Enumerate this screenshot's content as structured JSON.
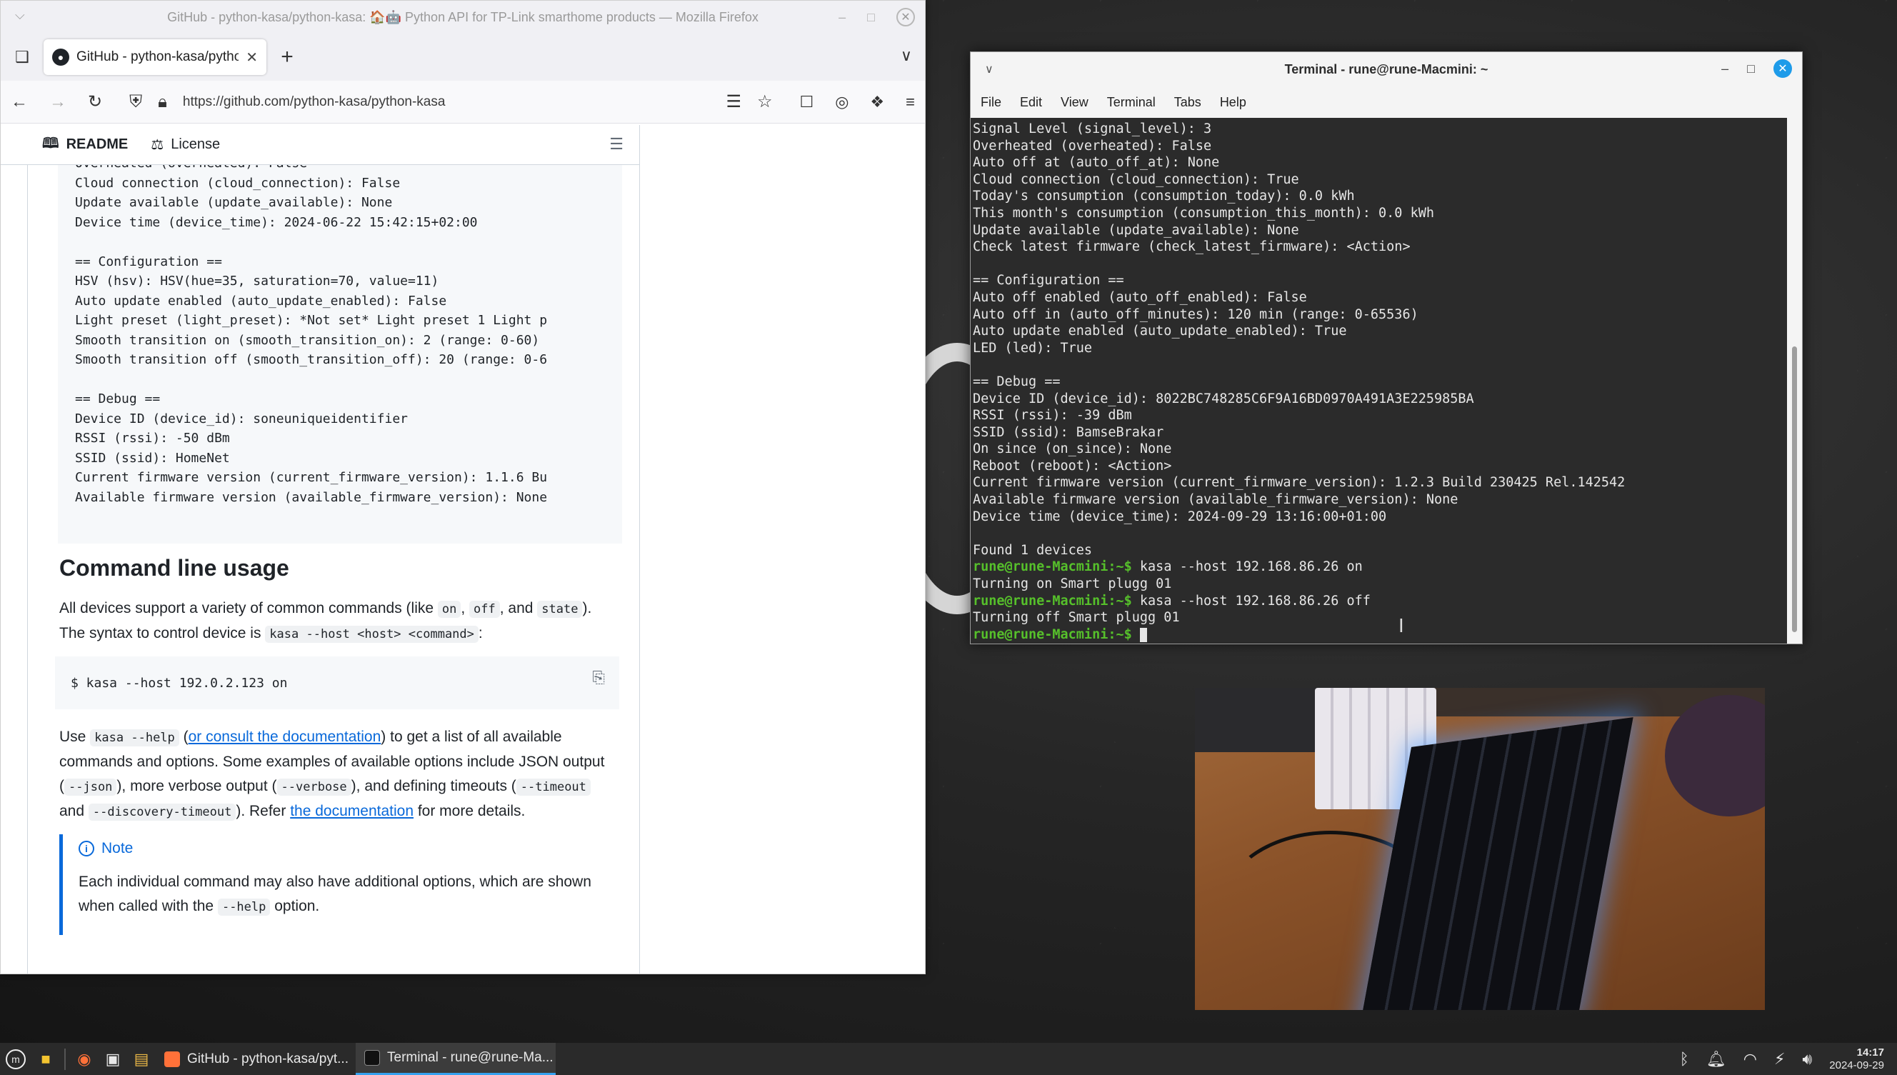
{
  "firefox": {
    "window_title": "GitHub - python-kasa/python-kasa: 🏠🤖 Python API for TP-Link smarthome products — Mozilla Firefox",
    "tab_title": "GitHub - python-kasa/pytho",
    "url": "https://github.com/python-kasa/python-kasa"
  },
  "readme": {
    "tab_readme": "README",
    "tab_license": "License",
    "code_top_cut": "Overheated (overheated): False",
    "code_lines": [
      "Cloud connection (cloud_connection): False",
      "Update available (update_available): None",
      "Device time (device_time): 2024-06-22 15:42:15+02:00",
      "",
      "== Configuration ==",
      "HSV (hsv): HSV(hue=35, saturation=70, value=11)",
      "Auto update enabled (auto_update_enabled): False",
      "Light preset (light_preset): *Not set* Light preset 1 Light p",
      "Smooth transition on (smooth_transition_on): 2 (range: 0-60)",
      "Smooth transition off (smooth_transition_off): 20 (range: 0-6",
      "",
      "== Debug ==",
      "Device ID (device_id): soneuniqueidentifier",
      "RSSI (rssi): -50 dBm",
      "SSID (ssid): HomeNet",
      "Current firmware version (current_firmware_version): 1.1.6 Bu",
      "Available firmware version (available_firmware_version): None"
    ],
    "heading": "Command line usage",
    "p1_a": "All devices support a variety of common commands (like ",
    "p1_on": "on",
    "p1_b": ", ",
    "p1_off": "off",
    "p1_c": ", and ",
    "p1_state": "state",
    "p1_d": "). The syntax to control device is ",
    "p1_syntax": "kasa --host <host> <command>",
    "p1_e": ":",
    "cmd_example": "$ kasa --host 192.0.2.123 on",
    "p2_a": "Use ",
    "p2_help": "kasa --help",
    "p2_b": " (",
    "p2_link1": "or consult the documentation",
    "p2_c": ") to get a list of all available commands and options. Some examples of available options include JSON output (",
    "p2_json": "--json",
    "p2_d": "), more verbose output (",
    "p2_verbose": "--verbose",
    "p2_e": "), and defining timeouts (",
    "p2_timeout": "--timeout",
    "p2_f": " and ",
    "p2_disc": "--discovery-timeout",
    "p2_g": "). Refer ",
    "p2_link2": "the documentation",
    "p2_h": " for more details.",
    "note_title": "Note",
    "note_a": "Each individual command may also have additional options, which are shown when called with the ",
    "note_help": "--help",
    "note_b": " option."
  },
  "terminal": {
    "title": "Terminal - rune@rune-Macmini: ~",
    "menu": [
      "File",
      "Edit",
      "View",
      "Terminal",
      "Tabs",
      "Help"
    ],
    "lines": [
      "Signal Level (signal_level): 3",
      "Overheated (overheated): False",
      "Auto off at (auto_off_at): None",
      "Cloud connection (cloud_connection): True",
      "Today's consumption (consumption_today): 0.0 kWh",
      "This month's consumption (consumption_this_month): 0.0 kWh",
      "Update available (update_available): None",
      "Check latest firmware (check_latest_firmware): <Action>",
      "",
      "== Configuration ==",
      "Auto off enabled (auto_off_enabled): False",
      "Auto off in (auto_off_minutes): 120 min (range: 0-65536)",
      "Auto update enabled (auto_update_enabled): True",
      "LED (led): True",
      "",
      "== Debug ==",
      "Device ID (device_id): 8022BC748285C6F9A16BD0970A491A3E225985BA",
      "RSSI (rssi): -39 dBm",
      "SSID (ssid): BamseBrakar",
      "On since (on_since): None",
      "Reboot (reboot): <Action>",
      "Current firmware version (current_firmware_version): 1.2.3 Build 230425 Rel.142542",
      "Available firmware version (available_firmware_version): None",
      "Device time (device_time): 2024-09-29 13:16:00+01:00",
      "",
      "Found 1 devices"
    ],
    "prompt": "rune@rune-Macmini:~$",
    "cmd1": " kasa --host 192.168.86.26 on",
    "out1": "Turning on Smart plugg 01",
    "cmd2": " kasa --host 192.168.86.26 off",
    "out2": "Turning off Smart plugg 01"
  },
  "taskbar": {
    "task_firefox": "GitHub - python-kasa/pyt...",
    "task_terminal": "Terminal - rune@rune-Ma...",
    "time": "14:17",
    "date": "2024-09-29"
  },
  "colors": {
    "prompt_green": "#56c02b",
    "link_blue": "#0969da",
    "active_task_accent": "#35a2f0"
  }
}
